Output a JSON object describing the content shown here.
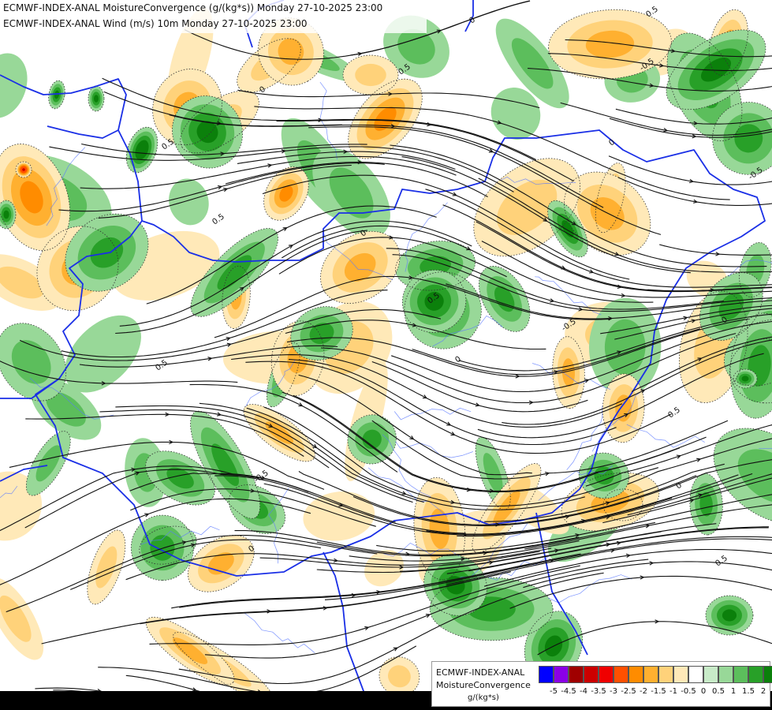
{
  "titles": {
    "line1": "ECMWF-INDEX-ANAL MoistureConvergence (g/(kg*s)) Monday 27-10-2025 23:00",
    "line2": "ECMWF-INDEX-ANAL Wind (m/s) 10m Monday 27-10-2025 23:00"
  },
  "legend": {
    "model": "ECMWF-INDEX-ANAL",
    "parameter": "MoistureConvergence",
    "unit": "g/(kg*s)",
    "tick_labels": [
      "-5",
      "-4.5",
      "-4",
      "-3.5",
      "-3",
      "-2.5",
      "-2",
      "-1.5",
      "-1",
      "-0.5",
      "0",
      "0.5",
      "1",
      "1.5",
      "2"
    ],
    "colors": [
      "#0000ff",
      "#8a00e6",
      "#a00000",
      "#cc0000",
      "#f00000",
      "#ff5000",
      "#ff8c00",
      "#ffb030",
      "#ffd27a",
      "#ffe9b8",
      "#ffffff",
      "#c8ebc8",
      "#98d898",
      "#5cbe5c",
      "#28a028",
      "#0b800b"
    ]
  },
  "map_labels": [
    "0.5",
    "0",
    "-0.5",
    "0.5",
    "0",
    "0.5",
    "0",
    "-0.5",
    "0.5",
    "0",
    "0.5",
    "-0.5",
    "0",
    "0.5",
    "0",
    "0.5",
    "-0.5",
    "0",
    "0.5",
    "0"
  ],
  "colors": {
    "border": "#1a2fe6",
    "river": "#5a78ff",
    "streamline": "#111111",
    "contour": "#333333"
  }
}
